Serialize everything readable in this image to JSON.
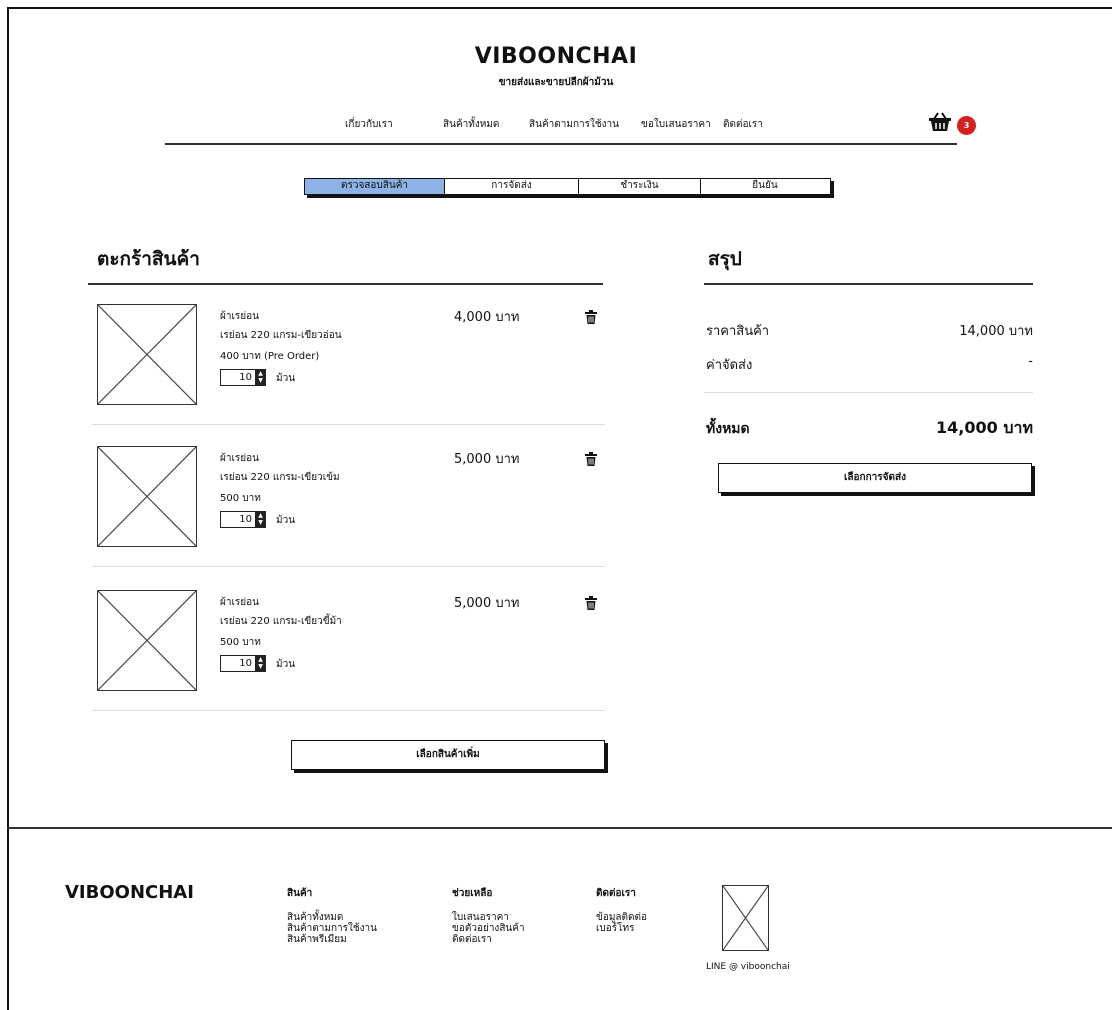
{
  "header": {
    "brand": "VIBOONCHAI",
    "tagline": "ขายส่งและขายปลีกผ้าม้วน",
    "nav": [
      "เกี่ยวกับเรา",
      "สินค้าทั้งหมด",
      "สินค้าตามการใช้งาน",
      "ขอใบเสนอราคา",
      "ติดต่อเรา"
    ],
    "cart_icon": "basket-icon",
    "cart_count": "3",
    "badge_color": "#d42020"
  },
  "steps": [
    {
      "label": "ตรวจสอบสินค้า",
      "active": true
    },
    {
      "label": "การจัดส่ง",
      "active": false
    },
    {
      "label": "ชำระเงิน",
      "active": false
    },
    {
      "label": "ยืนยัน",
      "active": false
    }
  ],
  "step_active_color": "#8cb2e6",
  "cart": {
    "title": "ตะกร้าสินค้า",
    "items": [
      {
        "name": "ผ้าเรย่อน",
        "variant": "เรย่อน 220 แกรม-เขียวอ่อน",
        "unit_price": "400 บาท  (Pre Order)",
        "qty": "10",
        "unit": "ม้วน",
        "price": "4,000 บาท"
      },
      {
        "name": "ผ้าเรย่อน",
        "variant": "เรย่อน 220 แกรม-เขียวเข้ม",
        "unit_price": "500 บาท",
        "qty": "10",
        "unit": "ม้วน",
        "price": "5,000 บาท"
      },
      {
        "name": "ผ้าเรย่อน",
        "variant": "เรย่อน 220 แกรม-เขียวขี้ม้า",
        "unit_price": "500 บาท",
        "qty": "10",
        "unit": "ม้วน",
        "price": "5,000 บาท"
      }
    ],
    "more_button": "เลือกสินค้าเพิ่ม"
  },
  "summary": {
    "title": "สรุป",
    "subtotal_label": "ราคาสินค้า",
    "subtotal_value": "14,000 บาท",
    "shipping_label": "ค่าจัดส่ง",
    "shipping_value": "-",
    "total_label": "ทั้งหมด",
    "total_value": "14,000 บาท",
    "shipping_button": "เลือกการจัดส่ง"
  },
  "footer": {
    "brand": "VIBOONCHAI",
    "columns": [
      {
        "heading": "สินค้า",
        "links": [
          "สินค้าทั้งหมด",
          "สินค้าตามการใช้งาน",
          "สินค้าพรีเมียม"
        ]
      },
      {
        "heading": "ช่วยเหลือ",
        "links": [
          "ใบเสนอราคา",
          "ขอตัวอย่างสินค้า",
          "ติดต่อเรา"
        ]
      },
      {
        "heading": "ติดต่อเรา",
        "links": [
          "ข้อมูลติดต่อ",
          "เบอร์โทร"
        ]
      }
    ],
    "line_id": "LINE @ viboonchai"
  }
}
